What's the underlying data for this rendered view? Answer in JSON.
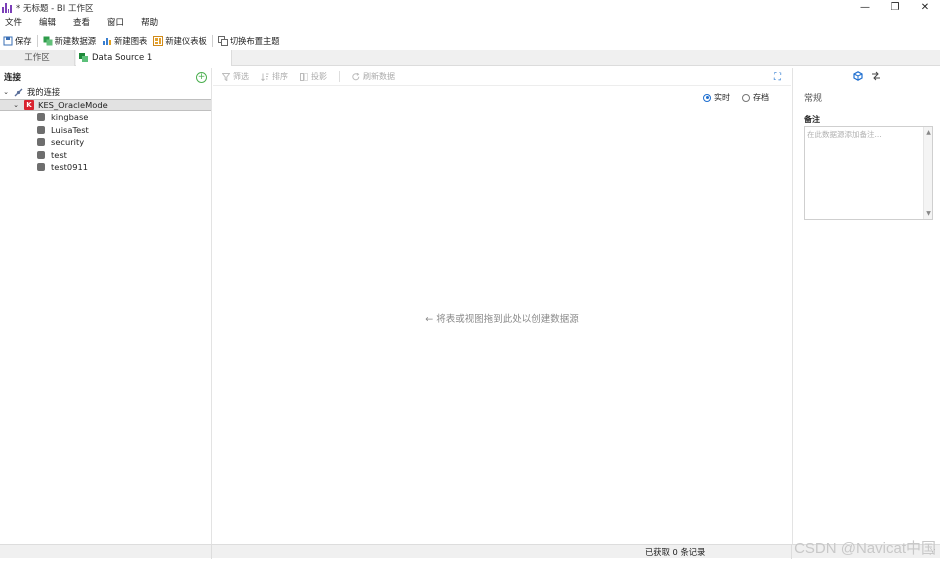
{
  "window": {
    "title": "* 无标题 - BI 工作区",
    "controls": [
      "—",
      "❐",
      "✕"
    ]
  },
  "menu": [
    "文件",
    "编辑",
    "查看",
    "窗口",
    "帮助"
  ],
  "toolbar": {
    "save": "保存",
    "new_datasource": "新建数据源",
    "new_chart": "新建图表",
    "new_dashboard": "新建仪表板",
    "switch_theme": "切换布置主题"
  },
  "tabs": {
    "workspace": "工作区",
    "datasource": "Data Source 1"
  },
  "left_panel": {
    "title": "连接",
    "my_connections": "我的连接",
    "connection_name": "KES_OracleMode",
    "databases": [
      "kingbase",
      "LuisaTest",
      "security",
      "test",
      "test0911"
    ]
  },
  "center_panel": {
    "tools": {
      "filter": "筛选",
      "sort": "排序",
      "project": "投影",
      "refresh": "刷新数据"
    },
    "modes": {
      "live": "实时",
      "archive": "存档",
      "selected": "live"
    },
    "drop_hint": "← 将表或视图拖到此处以创建数据源"
  },
  "right_panel": {
    "section": "常规",
    "note_label": "备注",
    "note_placeholder": "在此数据源添加备注..."
  },
  "status": {
    "records": "已获取 0 条记录"
  },
  "watermark": "CSDN @Navicat中国",
  "colors": {
    "accent": "#1f6fd0",
    "kes_red": "#d9232f",
    "ds_green": "#1e8a3a",
    "logo_purple": "#7b3fb8"
  }
}
